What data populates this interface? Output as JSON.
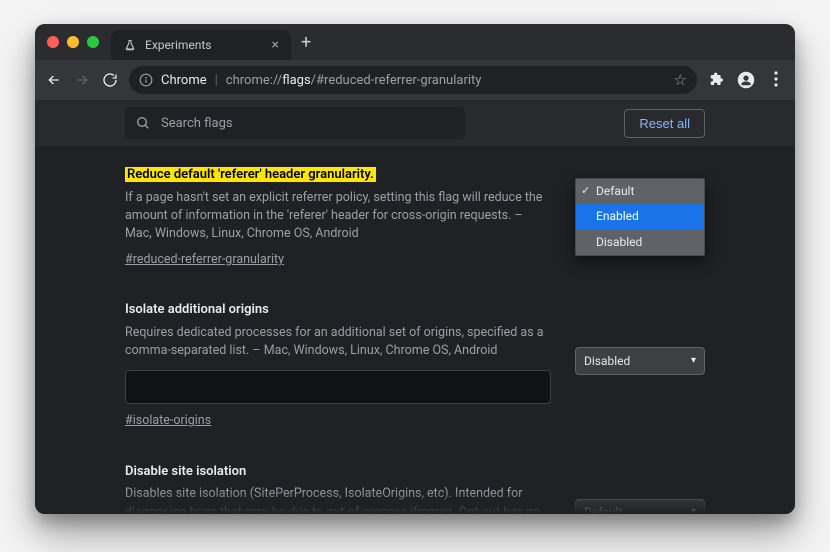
{
  "tab": {
    "title": "Experiments"
  },
  "omnibox": {
    "label": "Chrome",
    "url_dim": "chrome://",
    "url_bright": "flags",
    "url_hash": "/#reduced-referrer-granularity"
  },
  "topbar": {
    "search_placeholder": "Search flags",
    "reset_label": "Reset all"
  },
  "flags": [
    {
      "title": "Reduce default 'referer' header granularity.",
      "highlighted": true,
      "description": "If a page hasn't set an explicit referrer policy, setting this flag will reduce the amount of information in the 'referer' header for cross-origin requests. – Mac, Windows, Linux, Chrome OS, Android",
      "anchor": "#reduced-referrer-granularity",
      "selected": "Default",
      "dropdown_open": true,
      "options": [
        "Default",
        "Enabled",
        "Disabled"
      ],
      "options_checked": "Default",
      "options_highlight": "Enabled",
      "has_text_input": false
    },
    {
      "title": "Isolate additional origins",
      "highlighted": false,
      "description": "Requires dedicated processes for an additional set of origins, specified as a comma-separated list. – Mac, Windows, Linux, Chrome OS, Android",
      "anchor": "#isolate-origins",
      "selected": "Disabled",
      "dropdown_open": false,
      "has_text_input": true
    },
    {
      "title": "Disable site isolation",
      "highlighted": false,
      "description": "Disables site isolation (SitePerProcess, IsolateOrigins, etc). Intended for diagnosing bugs that may be due to out-of-process iframes. Opt-out has no effect if site isolation is force-enabled using a command line switch or using an enterprise policy. Caution: this disables",
      "anchor": "",
      "selected": "Default",
      "dropdown_open": false,
      "has_text_input": false
    }
  ]
}
